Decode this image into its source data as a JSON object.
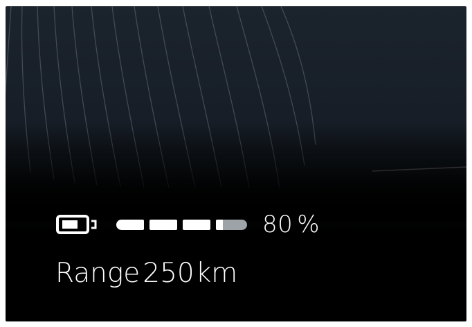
{
  "battery": {
    "icon": "battery-icon",
    "level_fraction": 0.8,
    "percent_value": "80",
    "percent_unit": "%"
  },
  "range": {
    "label": "Range",
    "value": "250",
    "unit": "km"
  },
  "colors": {
    "foreground": "#ffffff",
    "background": "#000000",
    "bar_remaining": "#9ea3a8"
  }
}
